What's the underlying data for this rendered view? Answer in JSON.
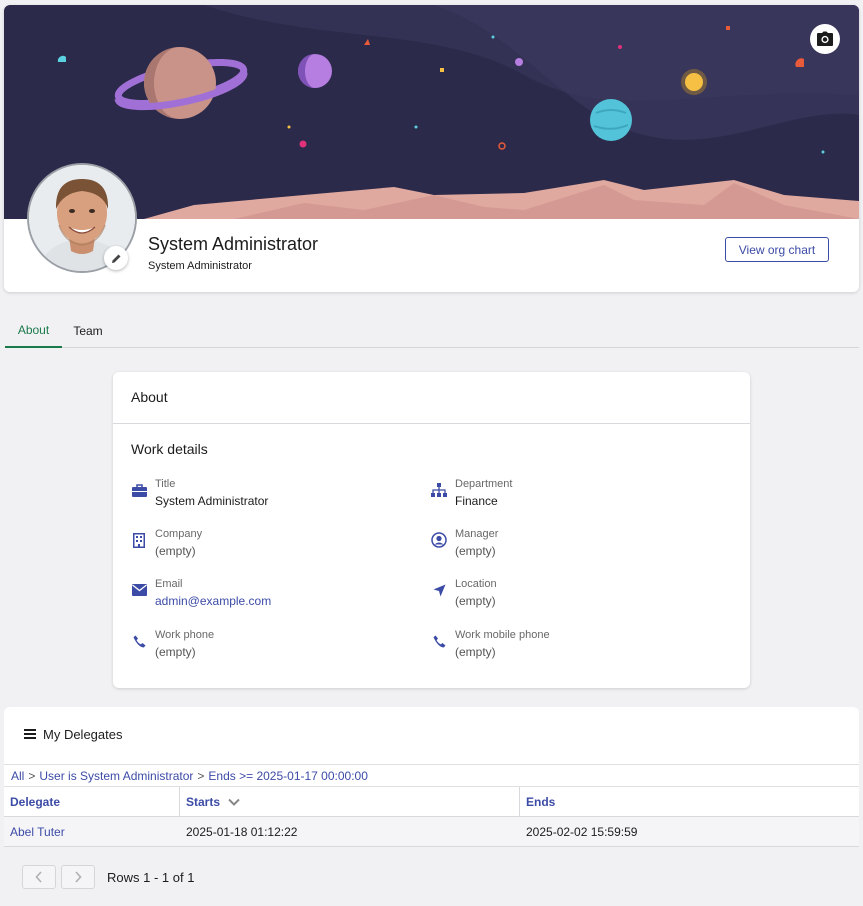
{
  "profile": {
    "name": "System Administrator",
    "subtitle": "System Administrator",
    "org_chart_label": "View org chart"
  },
  "tabs": [
    {
      "label": "About",
      "active": true
    },
    {
      "label": "Team",
      "active": false
    }
  ],
  "about": {
    "heading": "About",
    "section_title": "Work details",
    "fields": [
      {
        "label": "Title",
        "value": "System Administrator",
        "icon": "briefcase-icon"
      },
      {
        "label": "Department",
        "value": "Finance",
        "icon": "org-hierarchy-icon"
      },
      {
        "label": "Company",
        "value": "(empty)",
        "icon": "building-icon"
      },
      {
        "label": "Manager",
        "value": "(empty)",
        "icon": "user-circle-icon"
      },
      {
        "label": "Email",
        "value": "admin@example.com",
        "icon": "envelope-icon"
      },
      {
        "label": "Location",
        "value": "(empty)",
        "icon": "location-arrow-icon"
      },
      {
        "label": "Work phone",
        "value": "(empty)",
        "icon": "phone-icon"
      },
      {
        "label": "Work mobile phone",
        "value": "(empty)",
        "icon": "phone-icon"
      }
    ]
  },
  "delegates": {
    "title": "My Delegates",
    "breadcrumb": {
      "all": "All",
      "sep": ">",
      "filter1": "User is System Administrator",
      "filter2": "Ends >= 2025-01-17 00:00:00"
    },
    "columns": [
      "Delegate",
      "Starts",
      "Ends"
    ],
    "rows": [
      {
        "delegate": "Abel Tuter",
        "starts": "2025-01-18 01:12:22",
        "ends": "2025-02-02 15:59:59"
      }
    ],
    "pagination": "Rows 1 - 1 of 1"
  },
  "colors": {
    "accent": "#3c4ba6",
    "active_tab": "#1b7a4c",
    "banner_sky": "#2c2a4a",
    "banner_mountains": "#e0a9a0"
  }
}
